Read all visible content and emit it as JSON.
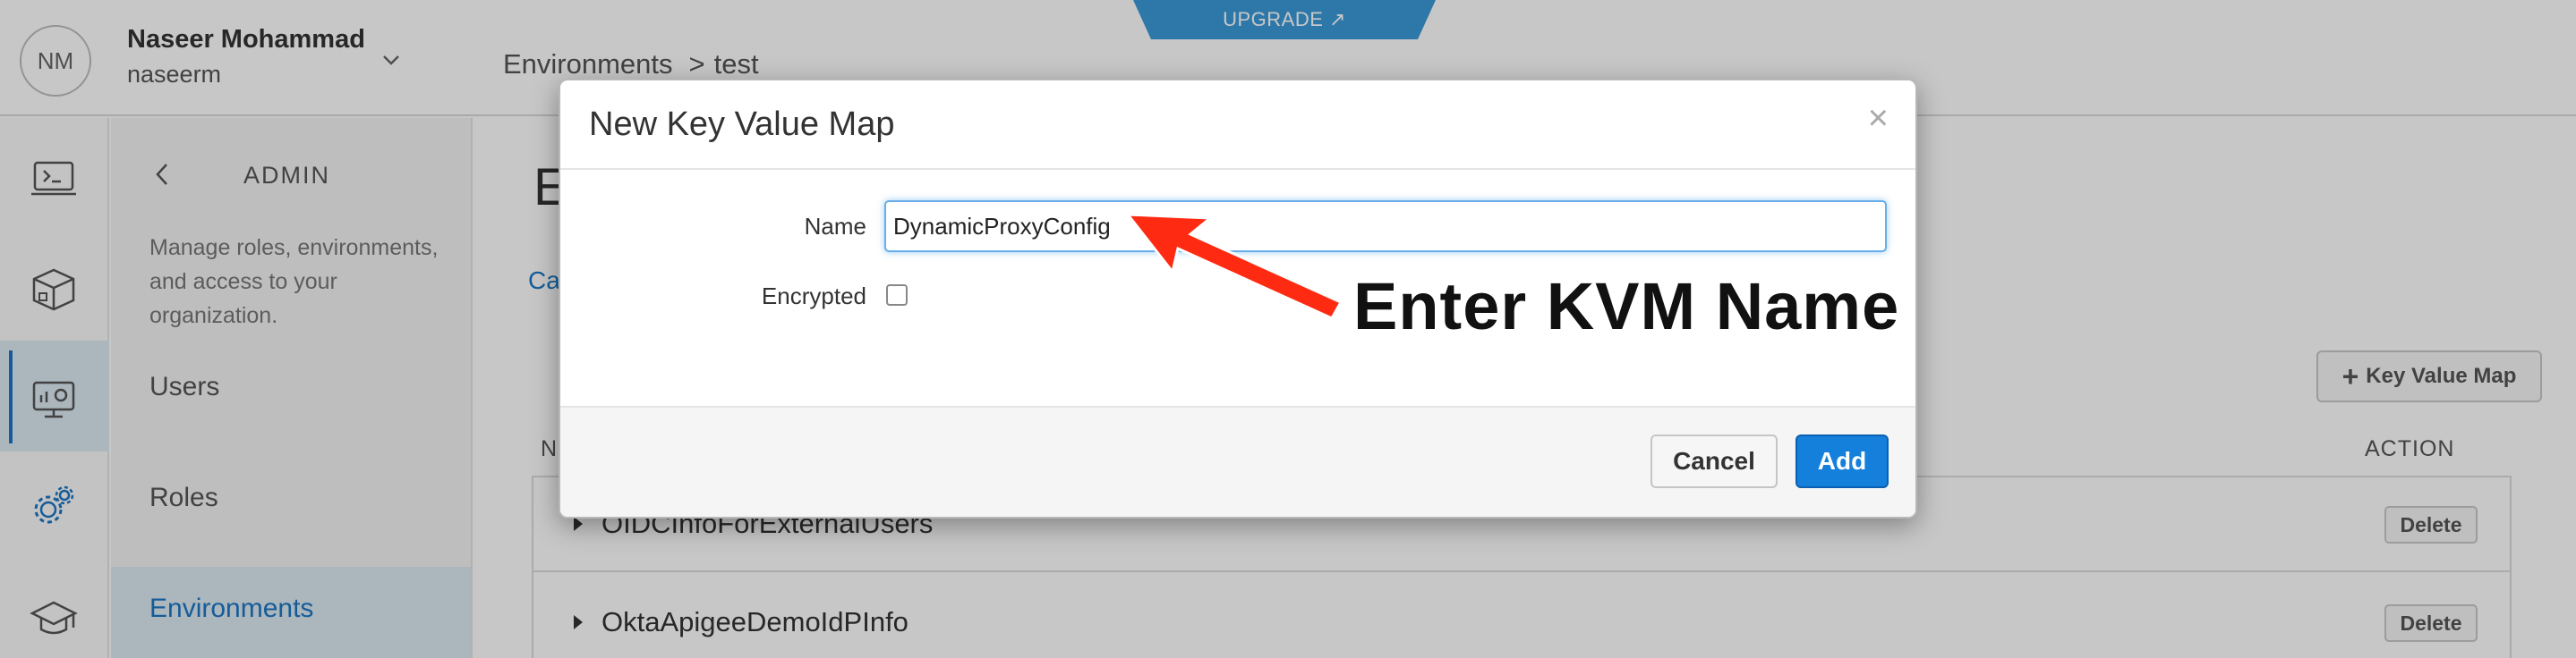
{
  "header": {
    "avatar_initials": "NM",
    "user_name": "Naseer Mohammad",
    "user_handle": "naseerm",
    "breadcrumb": [
      "Environments",
      ">",
      "test"
    ],
    "upgrade_label": "UPGRADE ↗"
  },
  "admin_nav": {
    "title": "ADMIN",
    "description": "Manage roles, environments, and access to your organization.",
    "items": [
      {
        "label": "Users"
      },
      {
        "label": "Roles"
      },
      {
        "label": "Environments",
        "active": true
      }
    ]
  },
  "main": {
    "heading_partial": "E",
    "tab_partial": "Ca",
    "add_button_label": "Key Value Map",
    "column_name_partial": "N",
    "column_action": "ACTION",
    "rows": [
      {
        "name": "OIDCInfoForExternalUsers",
        "delete_label": "Delete"
      },
      {
        "name": "OktaApigeeDemoIdPInfo",
        "delete_label": "Delete"
      }
    ]
  },
  "modal": {
    "title": "New Key Value Map",
    "close_glyph": "×",
    "name_label": "Name",
    "name_value": "DynamicProxyConfig",
    "encrypted_label": "Encrypted",
    "encrypted_checked": false,
    "cancel_label": "Cancel",
    "add_label": "Add"
  },
  "annotation": {
    "text": "Enter KVM Name",
    "arrow_color": "#ff2a12"
  },
  "colors": {
    "accent": "#1b77c5",
    "upgrade": "#3a9ad9",
    "primary_button": "#1580dc"
  }
}
